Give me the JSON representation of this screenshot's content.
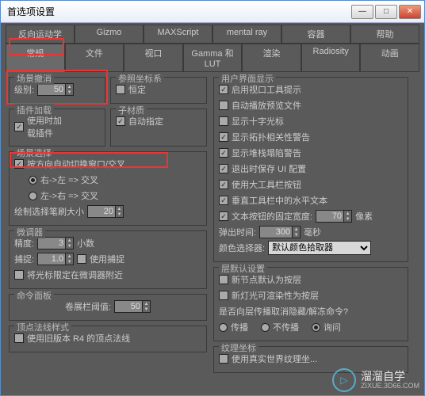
{
  "title": "首选项设置",
  "tabs_row1": [
    "反向运动学",
    "Gizmo",
    "MAXScript",
    "mental ray",
    "容器",
    "帮助"
  ],
  "tabs_row2": [
    "常规",
    "文件",
    "视口",
    "Gamma 和 LUT",
    "渲染",
    "Radiosity",
    "动画"
  ],
  "scene_undo": {
    "label": "场景撤消",
    "levels_label": "级别:",
    "levels": "50"
  },
  "refcoord": {
    "label": "参照坐标系",
    "constant": "恒定"
  },
  "plugin": {
    "label": "插件加载",
    "use": "使用时加\n载插件"
  },
  "submtl": {
    "label": "子材质",
    "auto": "自动指定"
  },
  "scenesel": {
    "label": "场景选择",
    "autoswitch": "按方向自动切换窗口/交叉",
    "rl": "右->左 => 交叉",
    "lr": "左->右 => 交叉",
    "brush_label": "绘制选择笔刷大小",
    "brush": "20"
  },
  "spinner": {
    "label": "微调器",
    "precision_label": "精度:",
    "precision": "3",
    "decimal": "小数",
    "snap_label": "捕捉:",
    "snap": "1.0",
    "usesnap": "使用捕捉",
    "limit": "将光标限定在微调器附近"
  },
  "cmdpanel": {
    "label": "命令面板",
    "rollup_label": "卷展栏阈值:",
    "rollup": "50"
  },
  "normals": {
    "label": "顶点法线样式",
    "r4": "使用旧版本 R4 的顶点法线"
  },
  "ui": {
    "label": "用户界面显示",
    "items": [
      "启用视口工具提示",
      "自动播放预览文件",
      "显示十字光标",
      "显示拓扑相关性警告",
      "显示堆栈塌陷警告",
      "退出时保存 UI 配置",
      "使用大工具栏按钮",
      "垂直工具栏中的水平文本"
    ],
    "fixedw_label": "文本按钮的固定宽度:",
    "fixedw": "70",
    "px": "像素",
    "flyout_label": "弹出时间:",
    "flyout": "300",
    "ms": "毫秒",
    "picker_label": "颜色选择器:",
    "picker": "默认颜色拾取器"
  },
  "layer": {
    "label": "层默认设置",
    "newnode": "新节点默认为按层",
    "newlight": "新灯光可渲染性为按层",
    "q": "是否向层传播取消隐藏/解冻命令?",
    "opts": [
      "传播",
      "不传播",
      "询问"
    ]
  },
  "texcoord": {
    "label": "纹理坐标",
    "realworld": "使用真实世界纹理坐..."
  },
  "wm": {
    "name": "溜溜自学",
    "url": "ZIXUE.3D66.COM"
  }
}
